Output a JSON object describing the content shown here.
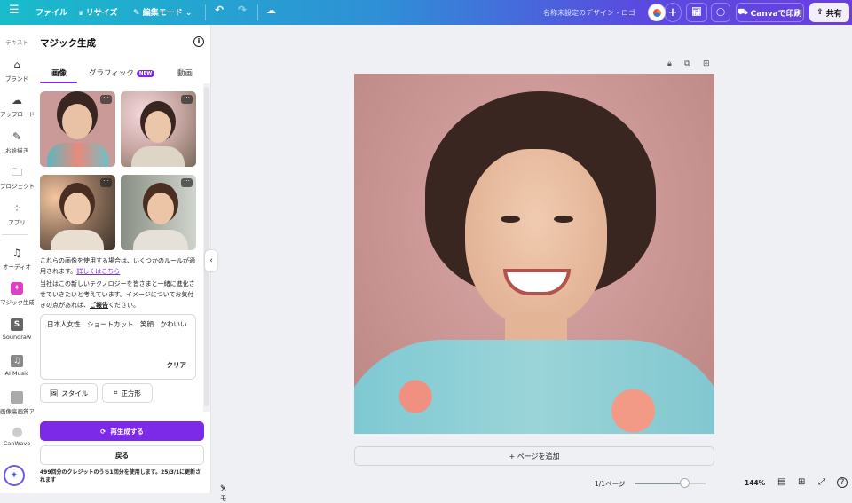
{
  "topbar": {
    "menu_icon": "hamburger-icon",
    "file": "ファイル",
    "resize": "リサイズ",
    "edit_mode": "編集モード",
    "design_title": "名称未設定のデザイン - ロゴ",
    "print": "Canvaで印刷",
    "share": "共有"
  },
  "rail": {
    "items": [
      {
        "label": "テキスト",
        "icon": "text-icon"
      },
      {
        "label": "ブランド",
        "icon": "brand-icon"
      },
      {
        "label": "アップロード",
        "icon": "upload-cloud-icon"
      },
      {
        "label": "お絵描き",
        "icon": "draw-icon"
      },
      {
        "label": "プロジェクト",
        "icon": "folder-icon"
      },
      {
        "label": "アプリ",
        "icon": "apps-icon"
      },
      {
        "label": "オーディオ",
        "icon": "music-icon"
      },
      {
        "label": "マジック生成",
        "icon": "magic-media-icon"
      },
      {
        "label": "Soundraw",
        "icon": "soundraw-icon"
      },
      {
        "label": "AI Music",
        "icon": "ai-music-icon"
      },
      {
        "label": "画像高画質ア...",
        "icon": "upscale-icon"
      },
      {
        "label": "CanWave",
        "icon": "canwave-icon"
      }
    ]
  },
  "panel": {
    "title": "マジック生成",
    "tabs": [
      {
        "label": "画像",
        "active": true
      },
      {
        "label": "グラフィック",
        "badge": "NEW"
      },
      {
        "label": "動画"
      }
    ],
    "notice": "これらの画像を使用する場合は、いくつかのルールが適用されます。",
    "notice_link": "詳しくはこちら",
    "feedback_pre": "当社はこの新しいテクノロジーを皆さまと一緒に進化させていきたいと考えています。イメージについてお気付きの点があれば、",
    "feedback_link": "ご報告",
    "feedback_post": "ください。",
    "prompt": "日本人女性　ショートカット　笑顔　かわいい",
    "clear": "クリア",
    "style": "スタイル",
    "aspect": "正方形",
    "regenerate": "再生成する",
    "back": "戻る",
    "credits": "499回分のクレジットのうち1回分を使用します。25/3/1に更新されます"
  },
  "footer": {
    "notes": "メモ",
    "add_page": "+ ページを追加",
    "page": "1/1ページ",
    "zoom": "144%",
    "zoom_value": 144
  }
}
